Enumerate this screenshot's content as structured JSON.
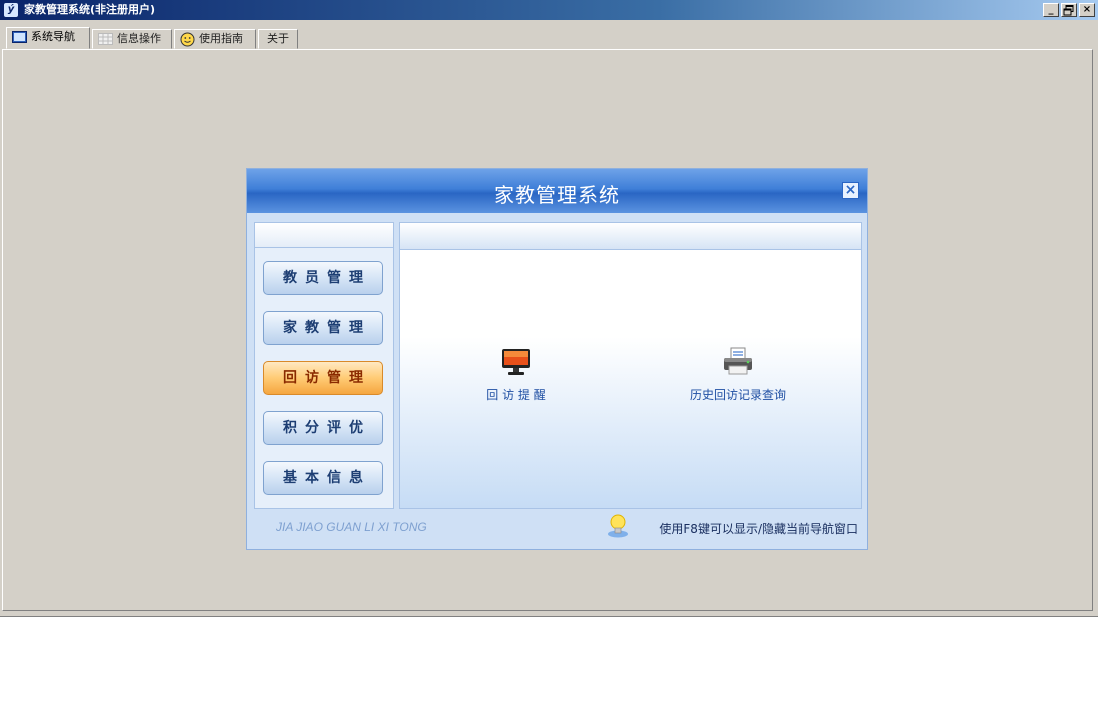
{
  "window": {
    "title": "家教管理系统(非注册用户)",
    "controls": {
      "minimize": "_",
      "maximize": "🗗",
      "close": "×"
    }
  },
  "tabs": [
    {
      "label": "系统导航",
      "icon": "monitor-icon",
      "active": true
    },
    {
      "label": "信息操作",
      "icon": "grid-icon",
      "active": false
    },
    {
      "label": "使用指南",
      "icon": "smiley-icon",
      "active": false
    },
    {
      "label": "关于",
      "icon": "",
      "active": false
    }
  ],
  "dialog": {
    "title": "家教管理系统",
    "close_icon": "×",
    "nav_buttons": [
      {
        "label": "教员管理",
        "active": false
      },
      {
        "label": "家教管理",
        "active": false
      },
      {
        "label": "回访管理",
        "active": true
      },
      {
        "label": "积分评优",
        "active": false
      },
      {
        "label": "基本信息",
        "active": false
      }
    ],
    "tiles": [
      {
        "label": "回 访 提 醒",
        "icon": "monitor-icon"
      },
      {
        "label": "历史回访记录查询",
        "icon": "printer-icon"
      }
    ],
    "footer": {
      "brand_text": "JIA JIAO GUAN LI XI TONG",
      "hint_text": "使用F8键可以显示/隐藏当前导航窗口",
      "hint_icon": "lightbulb-icon"
    }
  },
  "colors": {
    "titlebar": "#0a246a",
    "dialog_header": "#3f7fd8",
    "active_nav": "#ffcb75",
    "tile_label": "#1f4fa3"
  }
}
